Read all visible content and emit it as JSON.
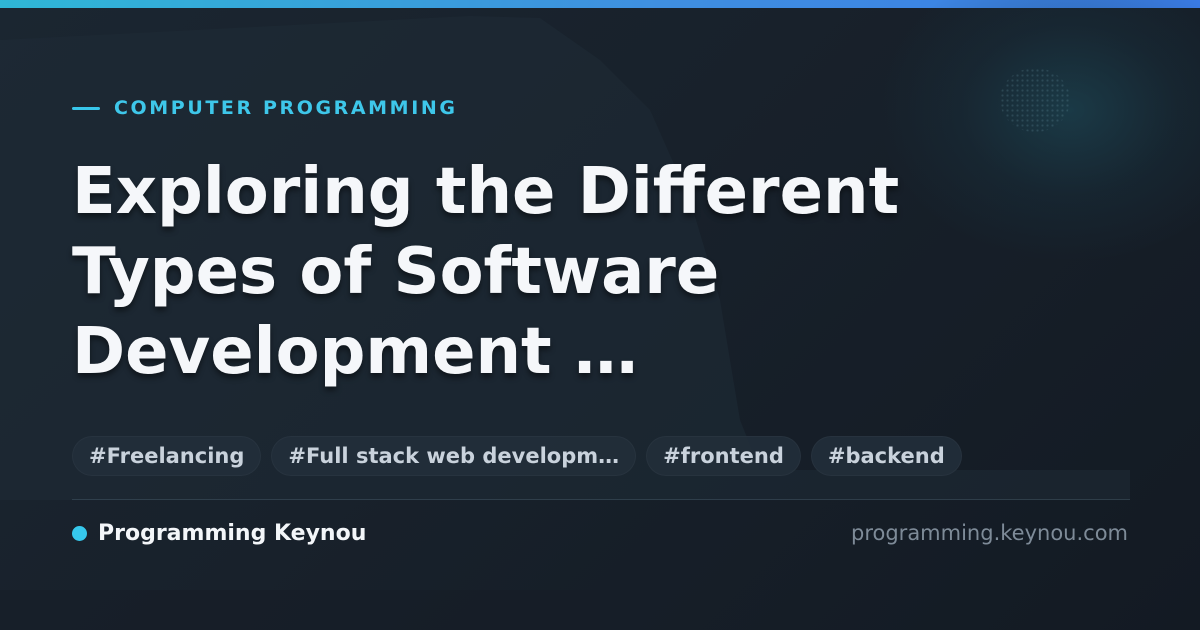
{
  "header": {
    "category": "COMPUTER PROGRAMMING"
  },
  "article": {
    "title_lines": [
      "Exploring the Different",
      "Types of Software",
      "Development …"
    ]
  },
  "tags": [
    "#Freelancing",
    "#Full stack web developm…",
    "#frontend",
    "#backend"
  ],
  "footer": {
    "brand": "Programming Keynou",
    "domain": "programming.keynou.com"
  },
  "colors": {
    "accent": "#38c6ea",
    "background": "#18212b",
    "title": "#f5f7fa",
    "tag_text": "#c9d2dc",
    "domain_text": "#7e8b98"
  }
}
